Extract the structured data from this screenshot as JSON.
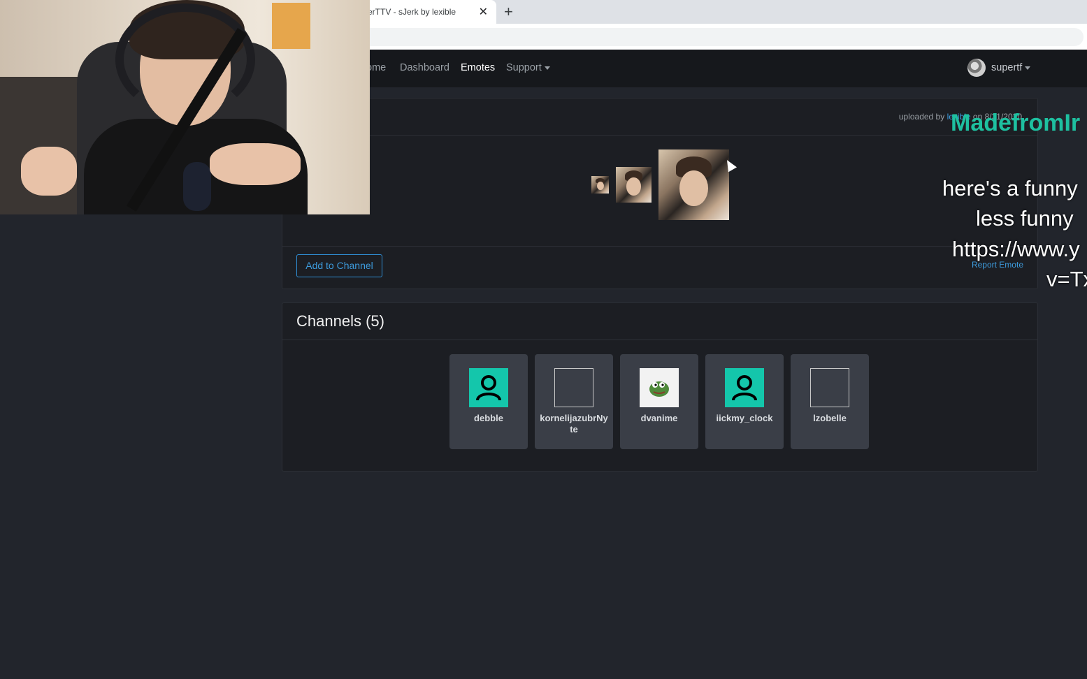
{
  "browser": {
    "tab_title": "erTTV - sJerk by lexible",
    "close_glyph": "✕",
    "new_tab_glyph": "+"
  },
  "navbar": {
    "items": [
      {
        "label": "ome"
      },
      {
        "label": "Dashboard"
      },
      {
        "label": "Emotes"
      },
      {
        "label": "Support"
      }
    ],
    "username": "supertf"
  },
  "emote": {
    "uploaded_prefix": "uploaded by ",
    "uploader": "lexible",
    "uploaded_suffix": " on 8/31/2020",
    "add_button": "Add to Channel",
    "report_link": "Report Emote"
  },
  "channels": {
    "title": "Channels (5)",
    "list": [
      {
        "name": "debble",
        "avatar": "user-icon"
      },
      {
        "name": "kornelijazubrNyte",
        "avatar": "broken-image"
      },
      {
        "name": "dvanime",
        "avatar": "pepe-frog"
      },
      {
        "name": "iickmy_clock",
        "avatar": "user-icon"
      },
      {
        "name": "lzobelle",
        "avatar": "broken-image"
      }
    ]
  },
  "overlay": {
    "brand": "MadefromIr",
    "lines": [
      "here's a funny",
      "less funny",
      "https://www.y",
      "v=Tx"
    ]
  },
  "colors": {
    "accent_teal": "#14c6ab",
    "link_blue": "#3d9bdc",
    "page_bg": "#22252c"
  }
}
